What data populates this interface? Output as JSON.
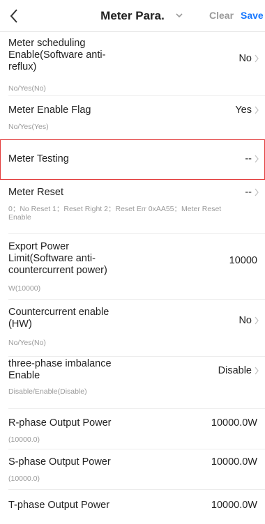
{
  "header": {
    "title": "Meter Para.",
    "clear_label": "Clear",
    "save_label": "Save"
  },
  "rows": [
    {
      "label": "Meter scheduling Enable(Software anti-reflux)",
      "value": "No",
      "hint": "No/Yes(No)",
      "arrow": true
    },
    {
      "label": "Meter Enable Flag",
      "value": "Yes",
      "hint": "No/Yes(Yes)",
      "arrow": true
    },
    {
      "label": "Meter Testing",
      "value": "--",
      "hint": "",
      "arrow": true,
      "highlighted": true
    },
    {
      "label": "Meter Reset",
      "value": "--",
      "hint": "0：No Reset 1：Reset Right  2：Reset Err  0xAA55：Meter Reset Enable",
      "arrow": true
    },
    {
      "label": "Export Power Limit(Software anti-countercurrent power)",
      "value": "10000",
      "hint": "W(10000)",
      "arrow": false
    },
    {
      "label": "Countercurrent enable (HW)",
      "value": "No",
      "hint": "No/Yes(No)",
      "arrow": true
    },
    {
      "label": "three-phase imbalance Enable",
      "value": "Disable",
      "hint": "Disable/Enable(Disable)",
      "arrow": true
    },
    {
      "label": "R-phase Output Power",
      "value": "10000.0W",
      "hint": "(10000.0)",
      "arrow": false
    },
    {
      "label": "S-phase Output Power",
      "value": "10000.0W",
      "hint": "(10000.0)",
      "arrow": false
    },
    {
      "label": "T-phase Output Power",
      "value": "10000.0W",
      "hint": "",
      "arrow": false
    }
  ]
}
